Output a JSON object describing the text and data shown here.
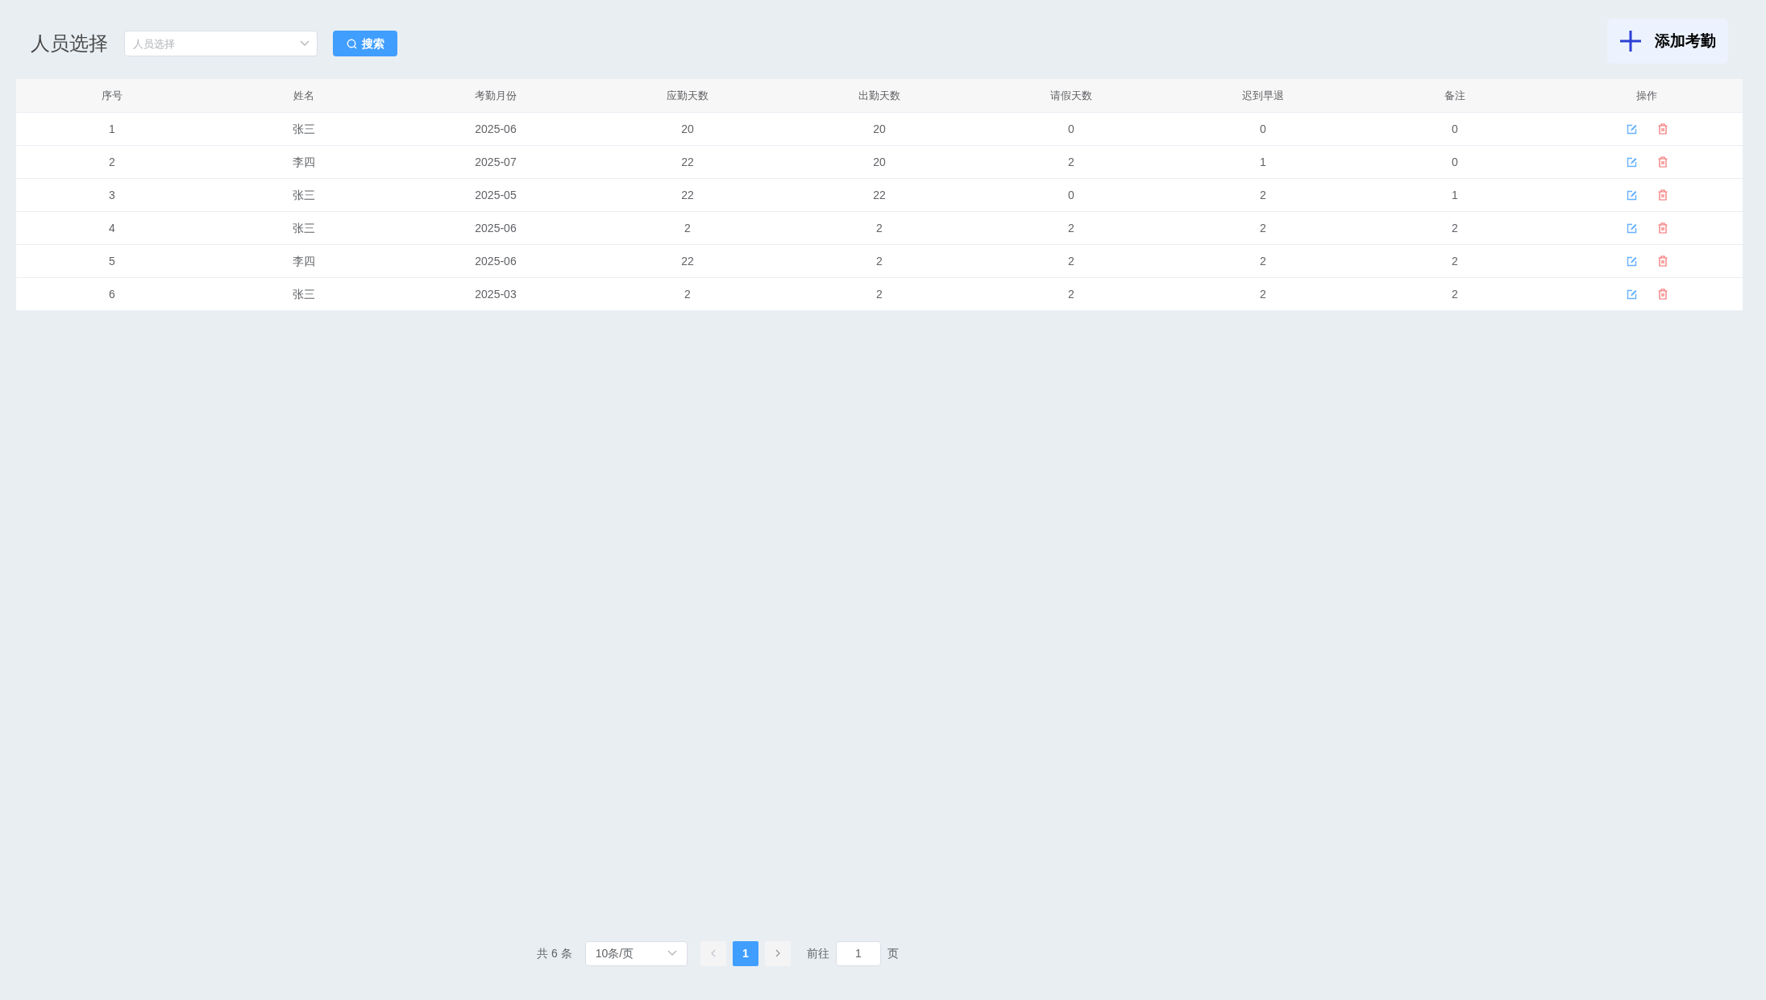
{
  "header": {
    "title": "人员选择",
    "person_select": {
      "placeholder": "人员选择"
    },
    "search_button": "搜索",
    "add_button": "添加考勤"
  },
  "table": {
    "columns": [
      "序号",
      "姓名",
      "考勤月份",
      "应勤天数",
      "出勤天数",
      "请假天数",
      "迟到早退",
      "备注",
      "操作"
    ],
    "rows": [
      {
        "cells": [
          "1",
          "张三",
          "2025-06",
          "20",
          "20",
          "0",
          "0",
          "0"
        ]
      },
      {
        "cells": [
          "2",
          "李四",
          "2025-07",
          "22",
          "20",
          "2",
          "1",
          "0"
        ]
      },
      {
        "cells": [
          "3",
          "张三",
          "2025-05",
          "22",
          "22",
          "0",
          "2",
          "1"
        ]
      },
      {
        "cells": [
          "4",
          "张三",
          "2025-06",
          "2",
          "2",
          "2",
          "2",
          "2"
        ]
      },
      {
        "cells": [
          "5",
          "李四",
          "2025-06",
          "22",
          "2",
          "2",
          "2",
          "2"
        ]
      },
      {
        "cells": [
          "6",
          "张三",
          "2025-03",
          "2",
          "2",
          "2",
          "2",
          "2"
        ]
      }
    ]
  },
  "pagination": {
    "total": "共 6 条",
    "page_size": "10条/页",
    "pages": [
      {
        "label": "1",
        "selected": true
      }
    ],
    "goto_label": "前往",
    "goto_value": "1",
    "page_suffix": "页"
  }
}
